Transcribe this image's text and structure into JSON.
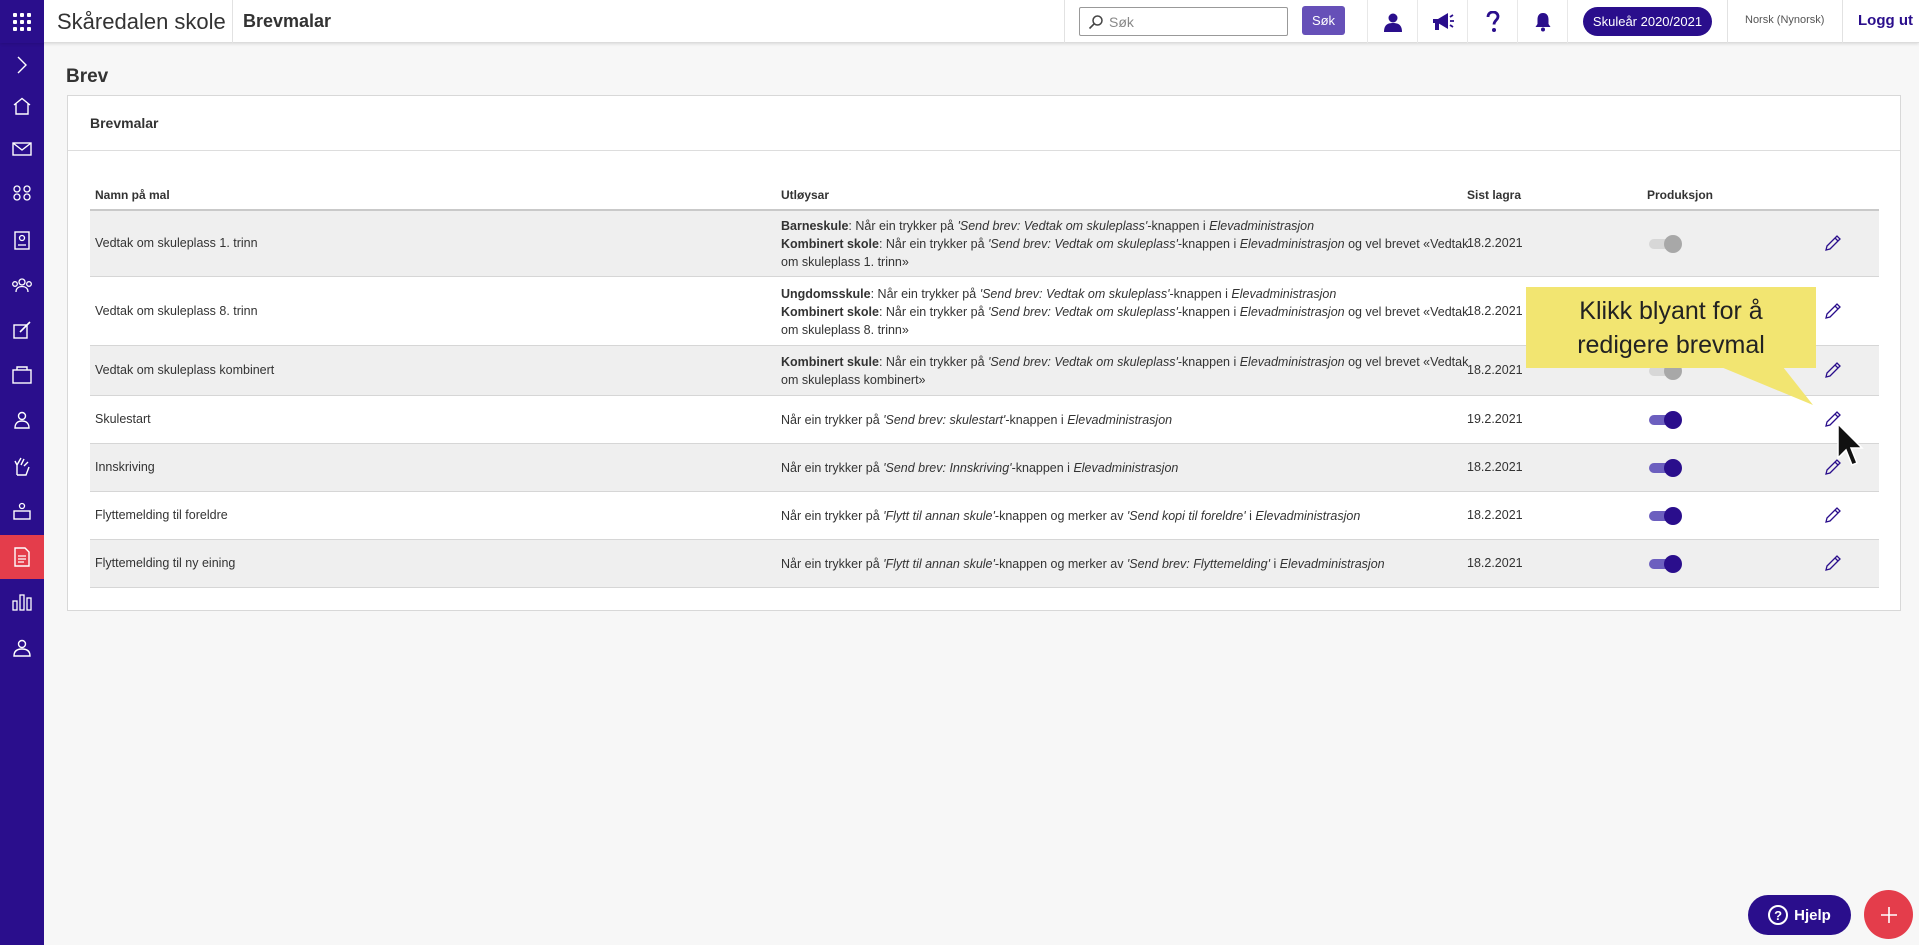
{
  "header": {
    "school_name": "Skåredalen skole",
    "page_name": "Brevmalar",
    "search_placeholder": "Søk",
    "search_button": "Søk",
    "school_year": "Skuleår 2020/2021",
    "language": "Norsk (Nynorsk)",
    "logout": "Logg ut"
  },
  "sidebar": {
    "items": [
      "expand",
      "home",
      "messages",
      "groups",
      "students",
      "teachers",
      "assessment",
      "courses",
      "user",
      "activities",
      "classroom",
      "letters",
      "statistics",
      "settings"
    ],
    "active": "letters"
  },
  "main": {
    "heading": "Brev",
    "panel_title": "Brevmalar",
    "columns": {
      "name": "Namn på mal",
      "trigger": "Utløysar",
      "saved": "Sist lagra",
      "production": "Produksjon"
    },
    "rows": [
      {
        "name": "Vedtak om skuleplass 1. trinn",
        "trigger": "<b>Barneskule</b>: Når ein trykker på <i>'Send brev: Vedtak om skuleplass'</i>-knappen i <i>Elevadministrasjon</i><br><b>Kombinert skole</b>: Når ein trykker på <i>'Send brev: Vedtak om skuleplass'</i>-knappen i <i>Elevadministrasjon</i> og vel brevet «Vedtak om skuleplass 1. trinn»",
        "saved": "18.2.2021",
        "production": false
      },
      {
        "name": "Vedtak om skuleplass 8. trinn",
        "trigger": "<b>Ungdomsskule</b>: Når ein trykker på <i>'Send brev: Vedtak om skuleplass'</i>-knappen i <i>Elevadministrasjon</i><br><b>Kombinert skole</b>: Når ein trykker på <i>'Send brev: Vedtak om skuleplass'</i>-knappen i <i>Elevadministrasjon</i> og vel brevet «Vedtak om skuleplass 8. trinn»",
        "saved": "18.2.2021",
        "production": false
      },
      {
        "name": "Vedtak om skuleplass kombinert",
        "trigger": "<b>Kombinert skule</b>: Når ein trykker på <i>'Send brev: Vedtak om skuleplass'</i>-knappen i <i>Elevadministrasjon</i> og vel brevet «Vedtak om skuleplass kombinert»",
        "saved": "18.2.2021",
        "production": false
      },
      {
        "name": "Skulestart",
        "trigger": "Når ein trykker på <i>'Send brev: skulestart'</i>-knappen i <i>Elevadministrasjon</i>",
        "saved": "19.2.2021",
        "production": true
      },
      {
        "name": "Innskriving",
        "trigger": "Når ein trykker på <i>'Send brev: Innskriving'</i>-knappen i <i>Elevadministrasjon</i>",
        "saved": "18.2.2021",
        "production": true
      },
      {
        "name": "Flyttemelding til foreldre",
        "trigger": "Når ein trykker på <i>'Flytt til annan skule'</i>-knappen og merker av <i>'Send kopi til foreldre'</i> i <i>Elevadministrasjon</i>",
        "saved": "18.2.2021",
        "production": true
      },
      {
        "name": "Flyttemelding til ny eining",
        "trigger": "Når ein trykker på <i>'Flytt til annan skule'</i>-knappen og merker av <i>'Send brev: Flyttemelding'</i> i <i>Elevadministrasjon</i>",
        "saved": "18.2.2021",
        "production": true
      }
    ]
  },
  "callout": {
    "text": "Klikk blyant for å redigere brevmal"
  },
  "footer": {
    "help_label": "Hjelp",
    "help_icon": "?"
  },
  "colors": {
    "primary": "#2a0e8c",
    "accent": "#e43d4b",
    "search_button": "#6650b8",
    "callout": "#f2e571"
  }
}
